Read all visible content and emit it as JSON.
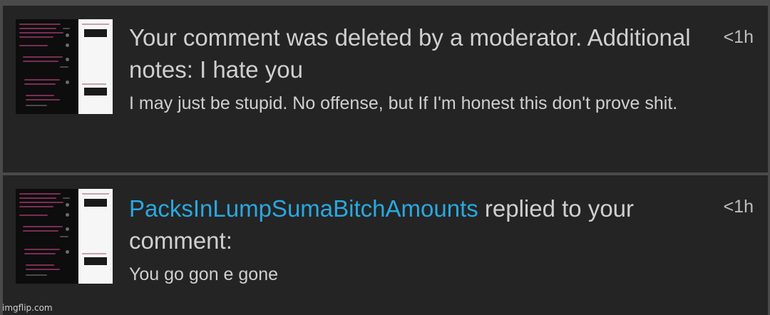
{
  "notifications": [
    {
      "title": "Your comment was deleted by a moderator. Additional notes: I hate you",
      "body": "I may just be stupid. No offense, but If I'm honest this don't prove shit.",
      "time": "<1h",
      "thumbnail": "screenshot-thumbnail"
    },
    {
      "username": "PacksInLumpSumaBitchAmounts",
      "action": " replied to your comment:",
      "body": "You go gon e gone",
      "time": "<1h",
      "thumbnail": "screenshot-thumbnail"
    }
  ],
  "watermark": "imgflip.com",
  "colors": {
    "background": "#4a4a4a",
    "card": "#242424",
    "text": "#cfcfcf",
    "username": "#29a8e0"
  }
}
